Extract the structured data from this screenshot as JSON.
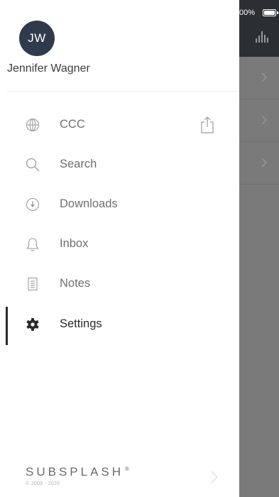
{
  "status_bar": {
    "battery_text": "00%"
  },
  "user": {
    "initials": "JW",
    "name": "Jennifer Wagner"
  },
  "menu": [
    {
      "label": "CCC",
      "icon": "globe-icon"
    },
    {
      "label": "Search",
      "icon": "search-icon"
    },
    {
      "label": "Downloads",
      "icon": "download-icon"
    },
    {
      "label": "Inbox",
      "icon": "bell-icon"
    },
    {
      "label": "Notes",
      "icon": "notes-icon"
    },
    {
      "label": "Settings",
      "icon": "gear-icon",
      "active": true
    }
  ],
  "footer": {
    "brand": "SUBSPLASH",
    "trademark": "®",
    "copyright": "© 2009 - 2020"
  },
  "colors": {
    "avatar": "#2f3b4c",
    "active_indicator": "#2a2a2a",
    "backdrop": "#7a7a7a",
    "topbar": "#2b2f34"
  }
}
